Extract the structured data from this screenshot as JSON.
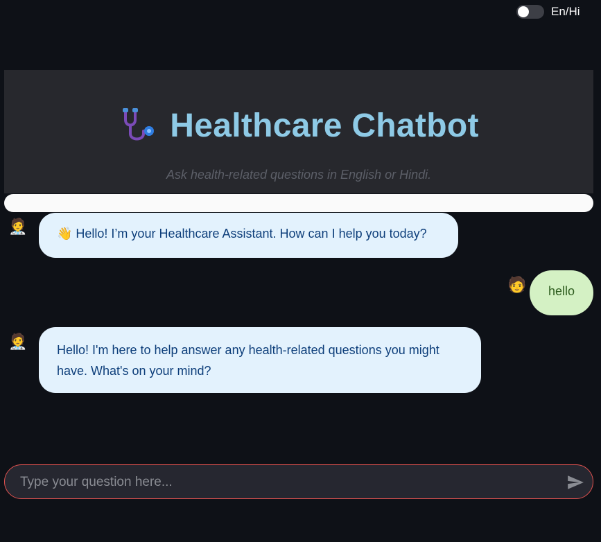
{
  "toggle": {
    "label": "En/Hi",
    "checked": false
  },
  "header": {
    "title": "Healthcare Chatbot",
    "subtitle": "Ask health-related questions in English or Hindi.",
    "icon": "stethoscope-icon"
  },
  "messages": [
    {
      "role": "assistant",
      "avatar": "🧑‍⚕️",
      "text": "👋 Hello! I’m your Healthcare Assistant. How can I help you today?"
    },
    {
      "role": "user",
      "avatar": "🧑",
      "text": "hello"
    },
    {
      "role": "assistant",
      "avatar": "🧑‍⚕️",
      "text": "Hello! I'm here to help answer any health-related questions you might have. What's on your mind?"
    }
  ],
  "input": {
    "placeholder": "Type your question here...",
    "value": ""
  },
  "colors": {
    "background": "#0e1117",
    "header_bg": "#27282d",
    "title": "#8ecae6",
    "bot_bubble": "#e3f2fd",
    "bot_text": "#0d3e7a",
    "user_bubble": "#d4f1c4",
    "user_text": "#2e5d1f",
    "input_border": "#e0514f"
  }
}
